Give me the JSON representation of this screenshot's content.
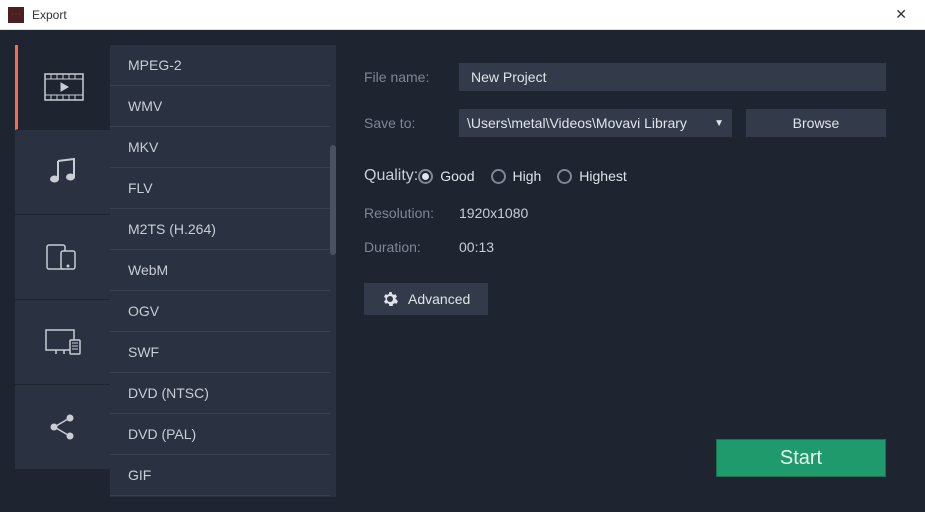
{
  "window": {
    "title": "Export"
  },
  "categories": [
    {
      "id": "video",
      "icon": "video-icon",
      "selected": true
    },
    {
      "id": "audio",
      "icon": "music-icon",
      "selected": false
    },
    {
      "id": "devices",
      "icon": "devices-icon",
      "selected": false
    },
    {
      "id": "tv",
      "icon": "tv-icon",
      "selected": false
    },
    {
      "id": "share",
      "icon": "share-icon",
      "selected": false
    }
  ],
  "formats": [
    "MPEG-2",
    "WMV",
    "MKV",
    "FLV",
    "M2TS (H.264)",
    "WebM",
    "OGV",
    "SWF",
    "DVD (NTSC)",
    "DVD (PAL)",
    "GIF"
  ],
  "form": {
    "file_name_label": "File name:",
    "file_name_value": "New Project",
    "save_to_label": "Save to:",
    "save_to_value": "\\Users\\metal\\Videos\\Movavi Library",
    "browse_label": "Browse",
    "quality_label": "Quality:",
    "quality_options": [
      {
        "label": "Good",
        "checked": true
      },
      {
        "label": "High",
        "checked": false
      },
      {
        "label": "Highest",
        "checked": false
      }
    ],
    "resolution_label": "Resolution:",
    "resolution_value": "1920x1080",
    "duration_label": "Duration:",
    "duration_value": "00:13",
    "advanced_label": "Advanced",
    "start_label": "Start"
  }
}
